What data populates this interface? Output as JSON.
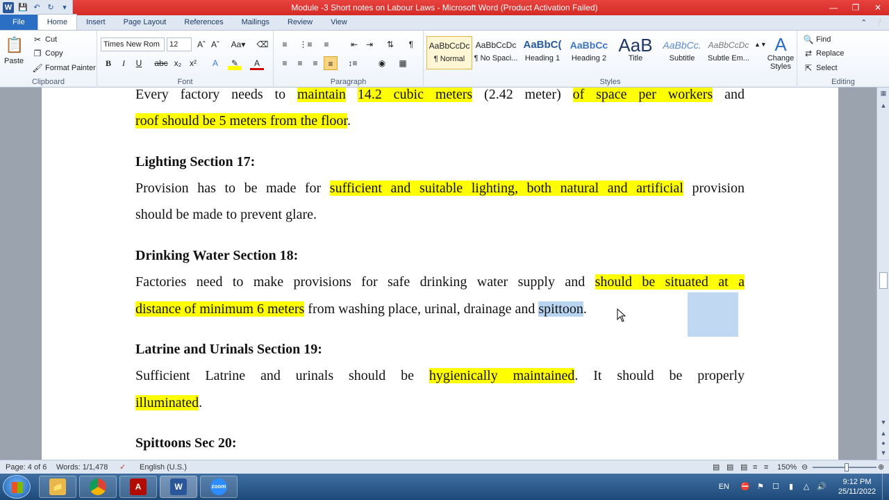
{
  "window": {
    "title": "Module -3 Short notes on Labour Laws  -  Microsoft Word (Product Activation Failed)",
    "controls": [
      "—",
      "❐",
      "✕"
    ]
  },
  "ribbon_tabs": [
    "File",
    "Home",
    "Insert",
    "Page Layout",
    "References",
    "Mailings",
    "Review",
    "View"
  ],
  "clipboard": {
    "paste": "Paste",
    "cut": "Cut",
    "copy": "Copy",
    "format_painter": "Format Painter",
    "label": "Clipboard"
  },
  "font": {
    "family": "Times New Rom",
    "size": "12",
    "label": "Font"
  },
  "paragraph": {
    "label": "Paragraph"
  },
  "styles": {
    "label": "Styles",
    "items": [
      {
        "sample": "AaBbCcDc",
        "name": "¶ Normal"
      },
      {
        "sample": "AaBbCcDc",
        "name": "¶ No Spaci..."
      },
      {
        "sample": "AaBbC(",
        "name": "Heading 1"
      },
      {
        "sample": "AaBbCc",
        "name": "Heading 2"
      },
      {
        "sample": "AaB",
        "name": "Title"
      },
      {
        "sample": "AaBbCc.",
        "name": "Subtitle"
      },
      {
        "sample": "AaBbCcDc",
        "name": "Subtle Em..."
      }
    ],
    "change_styles": "Change Styles"
  },
  "editing": {
    "find": "Find",
    "replace": "Replace",
    "select": "Select",
    "label": "Editing"
  },
  "document": {
    "line1": {
      "a": "Every factory needs to ",
      "b": "maintain",
      "c": " ",
      "d": "14.2 cubic meters",
      "e": " (2.42 meter) ",
      "f": "of space per workers",
      "g": " and"
    },
    "line2": {
      "a": "roof should be 5 meters from the floor",
      "b": "."
    },
    "h_lighting": "Lighting Section 17:",
    "lighting1": {
      "a": "Provision has to be made for ",
      "b": "sufficient and suitable lighting, both natural and artificial",
      "c": " provision"
    },
    "lighting2": "should be made to prevent glare.",
    "h_water": "Drinking Water Section 18:",
    "water1": {
      "a": "Factories need to make provisions for safe drinking water supply and ",
      "b": "should be situated at a"
    },
    "water2": {
      "a": "distance of minimum 6 meters",
      "b": " from washing place, urinal, drainage and ",
      "c": "spittoon",
      "d": "."
    },
    "h_latrine": "Latrine and Urinals Section 19:",
    "latrine1": {
      "a": "Sufficient Latrine and urinals should be ",
      "b": "hygienically maintained",
      "c": ". It should be properly"
    },
    "latrine2": {
      "a": "illuminated",
      "b": "."
    },
    "h_spittoons": "Spittoons Sec 20:"
  },
  "status": {
    "page": "Page: 4 of 6",
    "words": "Words: 1/1,478",
    "language": "English (U.S.)",
    "zoom": "150%"
  },
  "taskbar": {
    "lang": "EN",
    "time": "9:12 PM",
    "date": "25/11/2022"
  }
}
